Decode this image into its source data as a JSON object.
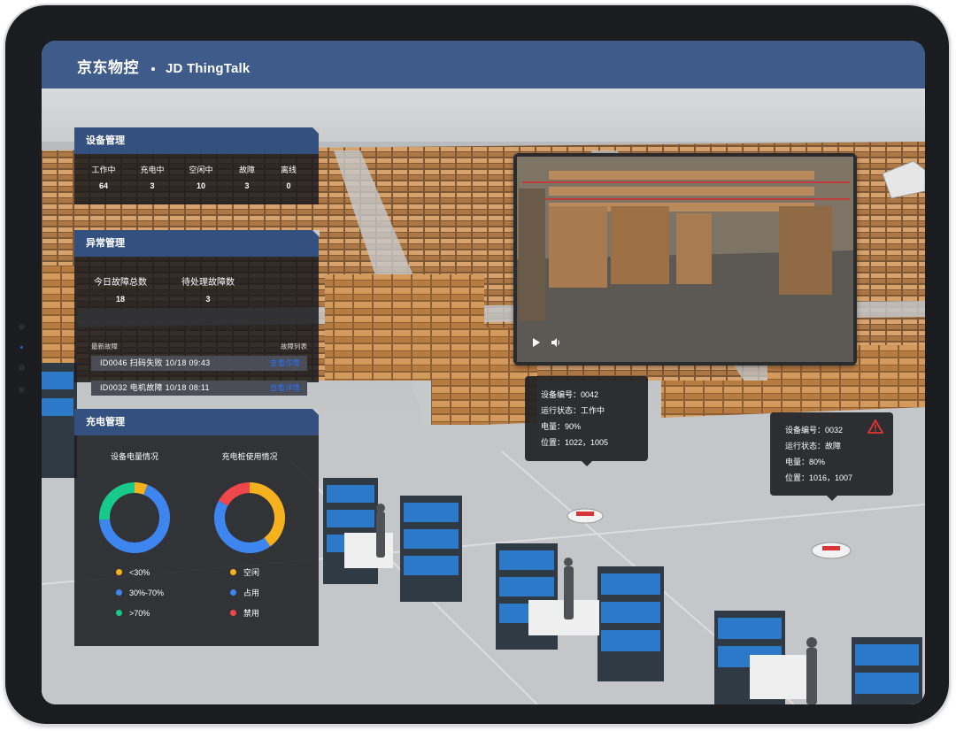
{
  "header": {
    "brand": "京东物控",
    "subtitle": "JD ThingTalk"
  },
  "device_panel": {
    "title": "设备管理",
    "stats": [
      {
        "label": "工作中",
        "value": "64"
      },
      {
        "label": "充电中",
        "value": "3"
      },
      {
        "label": "空闲中",
        "value": "10"
      },
      {
        "label": "故障",
        "value": "3"
      },
      {
        "label": "离线",
        "value": "0"
      }
    ]
  },
  "fault_panel": {
    "title": "异常管理",
    "today_label": "今日故障总数",
    "today_value": "18",
    "pending_label": "待处理故障数",
    "pending_value": "3",
    "latest_label": "最新故障",
    "list_link": "故障列表",
    "rows": [
      {
        "text": "ID0046   扫码失败   10/18   09:43",
        "link": "查看详情"
      },
      {
        "text": "ID0032   电机故障   10/18   08:11",
        "link": "查看详情"
      }
    ]
  },
  "charge_panel": {
    "title": "充电管理",
    "battery_title": "设备电量情况",
    "pile_title": "充电桩使用情况",
    "battery_legend": [
      {
        "label": "<30%",
        "color": "#f5b21e",
        "value": 0.06
      },
      {
        "label": "30%-70%",
        "color": "#3d86f0",
        "value": 0.68
      },
      {
        "label": ">70%",
        "color": "#17c98a",
        "value": 0.26
      }
    ],
    "pile_legend": [
      {
        "label": "空闲",
        "color": "#f5b21e",
        "value": 0.4
      },
      {
        "label": "占用",
        "color": "#3d86f0",
        "value": 0.43
      },
      {
        "label": "禁用",
        "color": "#f0474b",
        "value": 0.17
      }
    ]
  },
  "tooltips": [
    {
      "id": "0042",
      "lines": [
        "设备编号：0042",
        "运行状态：工作中",
        "电量：90%",
        "位置：1022，1005"
      ]
    },
    {
      "id": "0032",
      "lines": [
        "设备编号：0032",
        "运行状态：故障",
        "电量：80%",
        "位置：1016，1007"
      ],
      "warning": true
    }
  ],
  "colors": {
    "header_bg": "#3e5b8a",
    "panel_head": "#33507e",
    "link": "#2c6ef2",
    "warning": "#e2352f"
  }
}
